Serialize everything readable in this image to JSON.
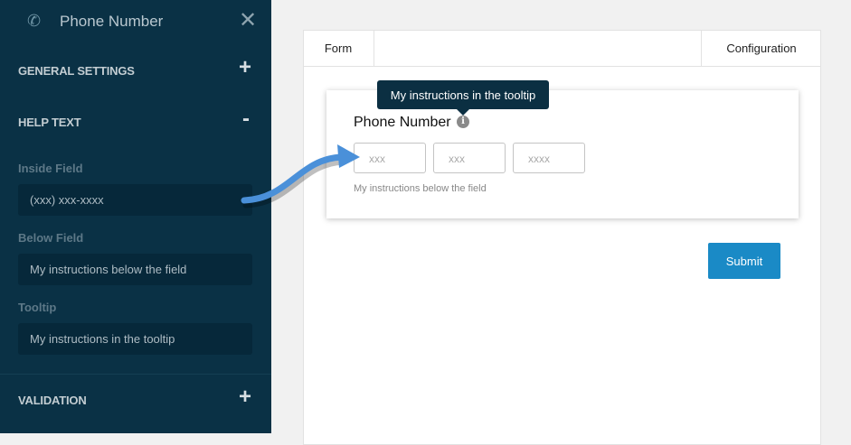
{
  "sidebar": {
    "title": "Phone Number",
    "sections": {
      "general": "GENERAL SETTINGS",
      "help": "HELP TEXT",
      "validation": "VALIDATION"
    },
    "expand": "+",
    "collapse": "-",
    "fields": {
      "inside_label": "Inside Field",
      "inside_value": "(xxx) xxx-xxxx",
      "below_label": "Below Field",
      "below_value": "My instructions below the field",
      "tooltip_label": "Tooltip",
      "tooltip_value": "My instructions in the tooltip"
    }
  },
  "tabs": {
    "form": "Form",
    "configuration": "Configuration"
  },
  "preview": {
    "tooltip": "My instructions in the tooltip",
    "label": "Phone Number",
    "placeholders": [
      "xxx",
      "xxx",
      "xxxx"
    ],
    "below": "My instructions below the field",
    "submit": "Submit"
  },
  "colors": {
    "sidebar": "#0a3145",
    "accent": "#1a8ac6",
    "arrow": "#4a90d9"
  }
}
